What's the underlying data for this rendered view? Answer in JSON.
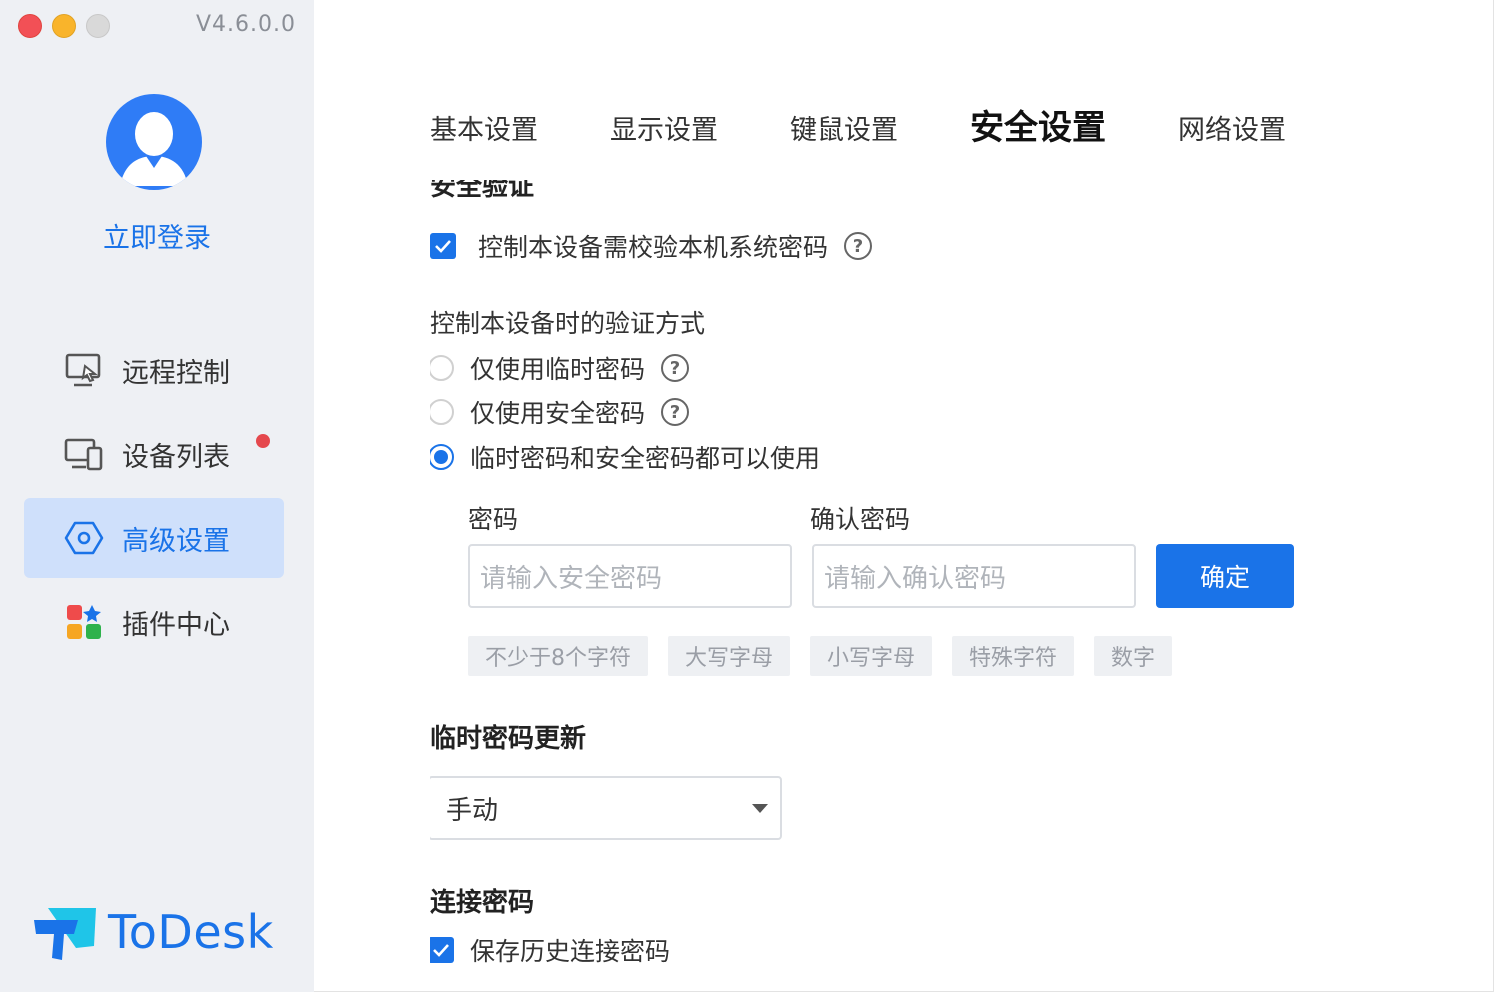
{
  "window": {
    "version": "V4.6.0.0"
  },
  "sidebar": {
    "login_label": "立即登录",
    "items": [
      {
        "label": "远程控制",
        "icon": "remote-control-icon"
      },
      {
        "label": "设备列表",
        "icon": "device-list-icon",
        "has_notification": true
      },
      {
        "label": "高级设置",
        "icon": "advanced-settings-icon",
        "active": true
      },
      {
        "label": "插件中心",
        "icon": "plugin-center-icon"
      }
    ],
    "brand": "ToDesk"
  },
  "tabs": [
    {
      "label": "基本设置"
    },
    {
      "label": "显示设置"
    },
    {
      "label": "键鼠设置"
    },
    {
      "label": "安全设置",
      "active": true
    },
    {
      "label": "网络设置"
    }
  ],
  "security": {
    "section_cut_title": "安全验证",
    "verify_system_password": {
      "label": "控制本设备需校验本机系统密码",
      "checked": true
    },
    "verify_method": {
      "title": "控制本设备时的验证方式",
      "options": [
        {
          "label": "仅使用临时密码",
          "selected": false
        },
        {
          "label": "仅使用安全密码",
          "selected": false
        },
        {
          "label": "临时密码和安全密码都可以使用",
          "selected": true
        }
      ]
    },
    "password": {
      "label": "密码",
      "placeholder": "请输入安全密码",
      "confirm_label": "确认密码",
      "confirm_placeholder": "请输入确认密码",
      "submit_label": "确定",
      "rules": [
        "不少于8个字符",
        "大写字母",
        "小写字母",
        "特殊字符",
        "数字"
      ]
    },
    "temp_update": {
      "title": "临时密码更新",
      "value": "手动"
    },
    "connection_password": {
      "title": "连接密码",
      "save_history": {
        "label": "保存历史连接密码",
        "checked": true
      }
    }
  },
  "colors": {
    "accent": "#1a73e8",
    "sidebar_bg": "#eef0f4",
    "active_bg": "#cfe0fb",
    "badge": "#e5484d"
  }
}
